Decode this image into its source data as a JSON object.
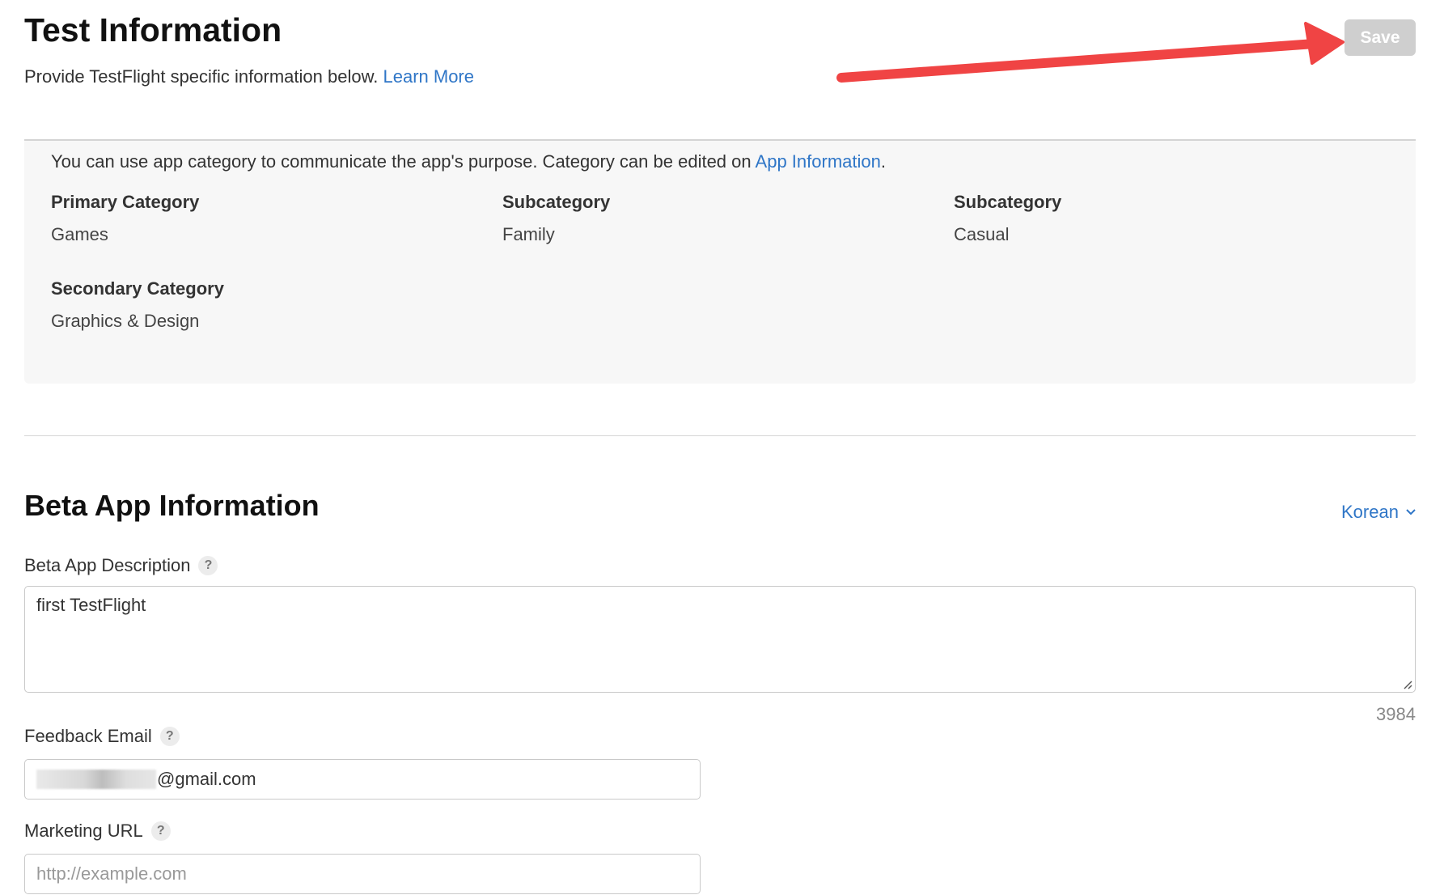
{
  "header": {
    "title": "Test Information",
    "intro_text": "Provide TestFlight specific information below.",
    "learn_more": "Learn More",
    "save_label": "Save"
  },
  "category": {
    "note_text": "You can use app category to communicate the app's purpose. Category can be edited on",
    "note_link": "App Information",
    "note_end": ".",
    "primary_heading": "Primary Category",
    "primary_value": "Games",
    "sub1_heading": "Subcategory",
    "sub1_value": "Family",
    "sub2_heading": "Subcategory",
    "sub2_value": "Casual",
    "secondary_heading": "Secondary Category",
    "secondary_value": "Graphics & Design"
  },
  "beta": {
    "section_title": "Beta App Information",
    "language": "Korean",
    "description_label": "Beta App Description",
    "description_value": "first TestFlight",
    "char_count": "3984",
    "feedback_label": "Feedback Email",
    "feedback_value_suffix": "@gmail.com",
    "marketing_label": "Marketing URL",
    "marketing_placeholder": "http://example.com"
  },
  "colors": {
    "link": "#2f76c7",
    "arrow": "#f04444",
    "save_disabled": "#cfcfcf"
  },
  "icons": {
    "help": "?"
  }
}
